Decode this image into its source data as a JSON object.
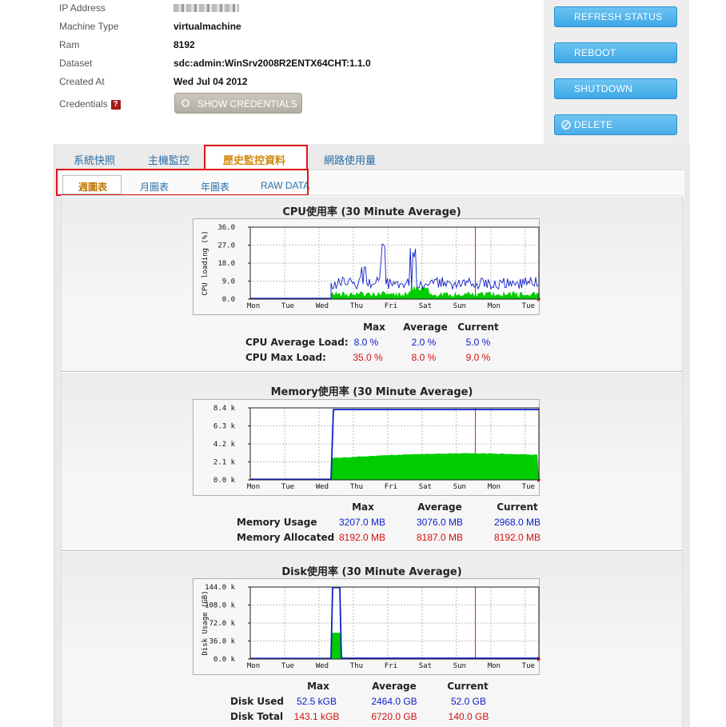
{
  "info": {
    "ip_label": "IP Address",
    "machine_type_label": "Machine Type",
    "machine_type_value": "virtualmachine",
    "ram_label": "Ram",
    "ram_value": "8192",
    "dataset_label": "Dataset",
    "dataset_value": "sdc:admin:WinSrv2008R2ENTX64CHT:1.1.0",
    "created_label": "Created At",
    "created_value": "Wed Jul 04 2012",
    "credentials_label": "Credentials",
    "help_glyph": "?",
    "show_credentials": "SHOW CREDENTIALS"
  },
  "actions": {
    "refresh": "REFRESH STATUS",
    "reboot": "REBOOT",
    "shutdown": "SHUTDOWN",
    "delete": "DELETE"
  },
  "tabs": [
    "系統快照",
    "主機監控",
    "歷史監控資料",
    "網路使用量"
  ],
  "subtabs": [
    "週圖表",
    "月圖表",
    "年圖表",
    "RAW DATA"
  ],
  "days": [
    "Mon",
    "Tue",
    "Wed",
    "Thu",
    "Fri",
    "Sat",
    "Sun",
    "Mon",
    "Tue"
  ],
  "colors": {
    "accent_blue": "#3da8e6",
    "avg_line": "#1020c8",
    "fill_green": "#00cc00",
    "max_red": "#d41010",
    "now_line": "#e02020",
    "highlight": "#e0141c"
  },
  "stats_headers": {
    "max": "Max",
    "average": "Average",
    "current": "Current"
  },
  "cpu": {
    "title": "CPU使用率 (30 Minute Average)",
    "ylabel": "CPU loading (%)",
    "ticks": [
      "36.0",
      "27.0",
      "18.0",
      "9.0",
      "0.0"
    ],
    "rows": [
      {
        "label": "CPU Average Load:",
        "max": "8.0 %",
        "avg": "2.0 %",
        "cur": "5.0 %"
      },
      {
        "label": "CPU Max Load:",
        "max": "35.0 %",
        "avg": "8.0 %",
        "cur": "9.0 %"
      }
    ]
  },
  "memory": {
    "title": "Memory使用率 (30 Minute Average)",
    "ticks": [
      "8.4 k",
      "6.3 k",
      "4.2 k",
      "2.1 k",
      "0.0 k"
    ],
    "rows": [
      {
        "label": "Memory Usage",
        "max": "3207.0 MB",
        "avg": "3076.0 MB",
        "cur": "2968.0 MB"
      },
      {
        "label": "Memory Allocated",
        "max": "8192.0 MB",
        "avg": "8187.0 MB",
        "cur": "8192.0 MB"
      }
    ]
  },
  "disk": {
    "title": "Disk使用率 (30 Minute Average)",
    "ylabel": "Disk Usage (GB)",
    "ticks": [
      "144.0 k",
      "108.0 k",
      "72.0 k",
      "36.0 k",
      "0.0 k"
    ],
    "rows": [
      {
        "label": "Disk Used",
        "max": "52.5 kGB",
        "avg": "2464.0 GB",
        "cur": "52.0 GB"
      },
      {
        "label": "Disk Total",
        "max": "143.1 kGB",
        "avg": "6720.0 GB",
        "cur": "140.0 GB"
      }
    ]
  }
}
